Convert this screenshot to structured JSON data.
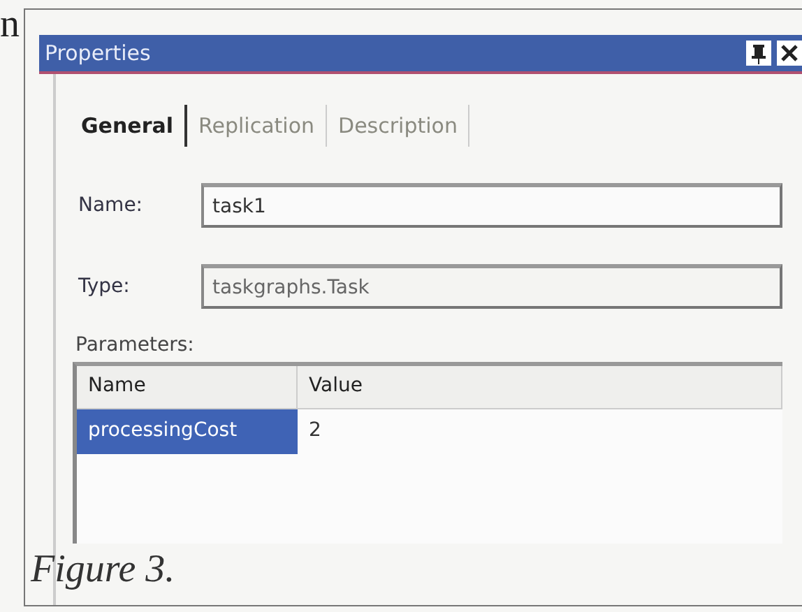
{
  "page_fragment": "n",
  "window": {
    "title": "Properties"
  },
  "tabs": [
    {
      "label": "General",
      "selected": true
    },
    {
      "label": "Replication",
      "selected": false
    },
    {
      "label": "Description",
      "selected": false
    }
  ],
  "fields": [
    {
      "label": "Name:",
      "value": "task1",
      "disabled": false
    },
    {
      "label": "Type:",
      "value": "taskgraphs.Task",
      "disabled": true
    }
  ],
  "parameters": {
    "label": "Parameters:",
    "columns": [
      "Name",
      "Value"
    ],
    "rows": [
      {
        "name": "processingCost",
        "value": "2",
        "selected": true
      }
    ]
  },
  "caption": "Figure 3."
}
